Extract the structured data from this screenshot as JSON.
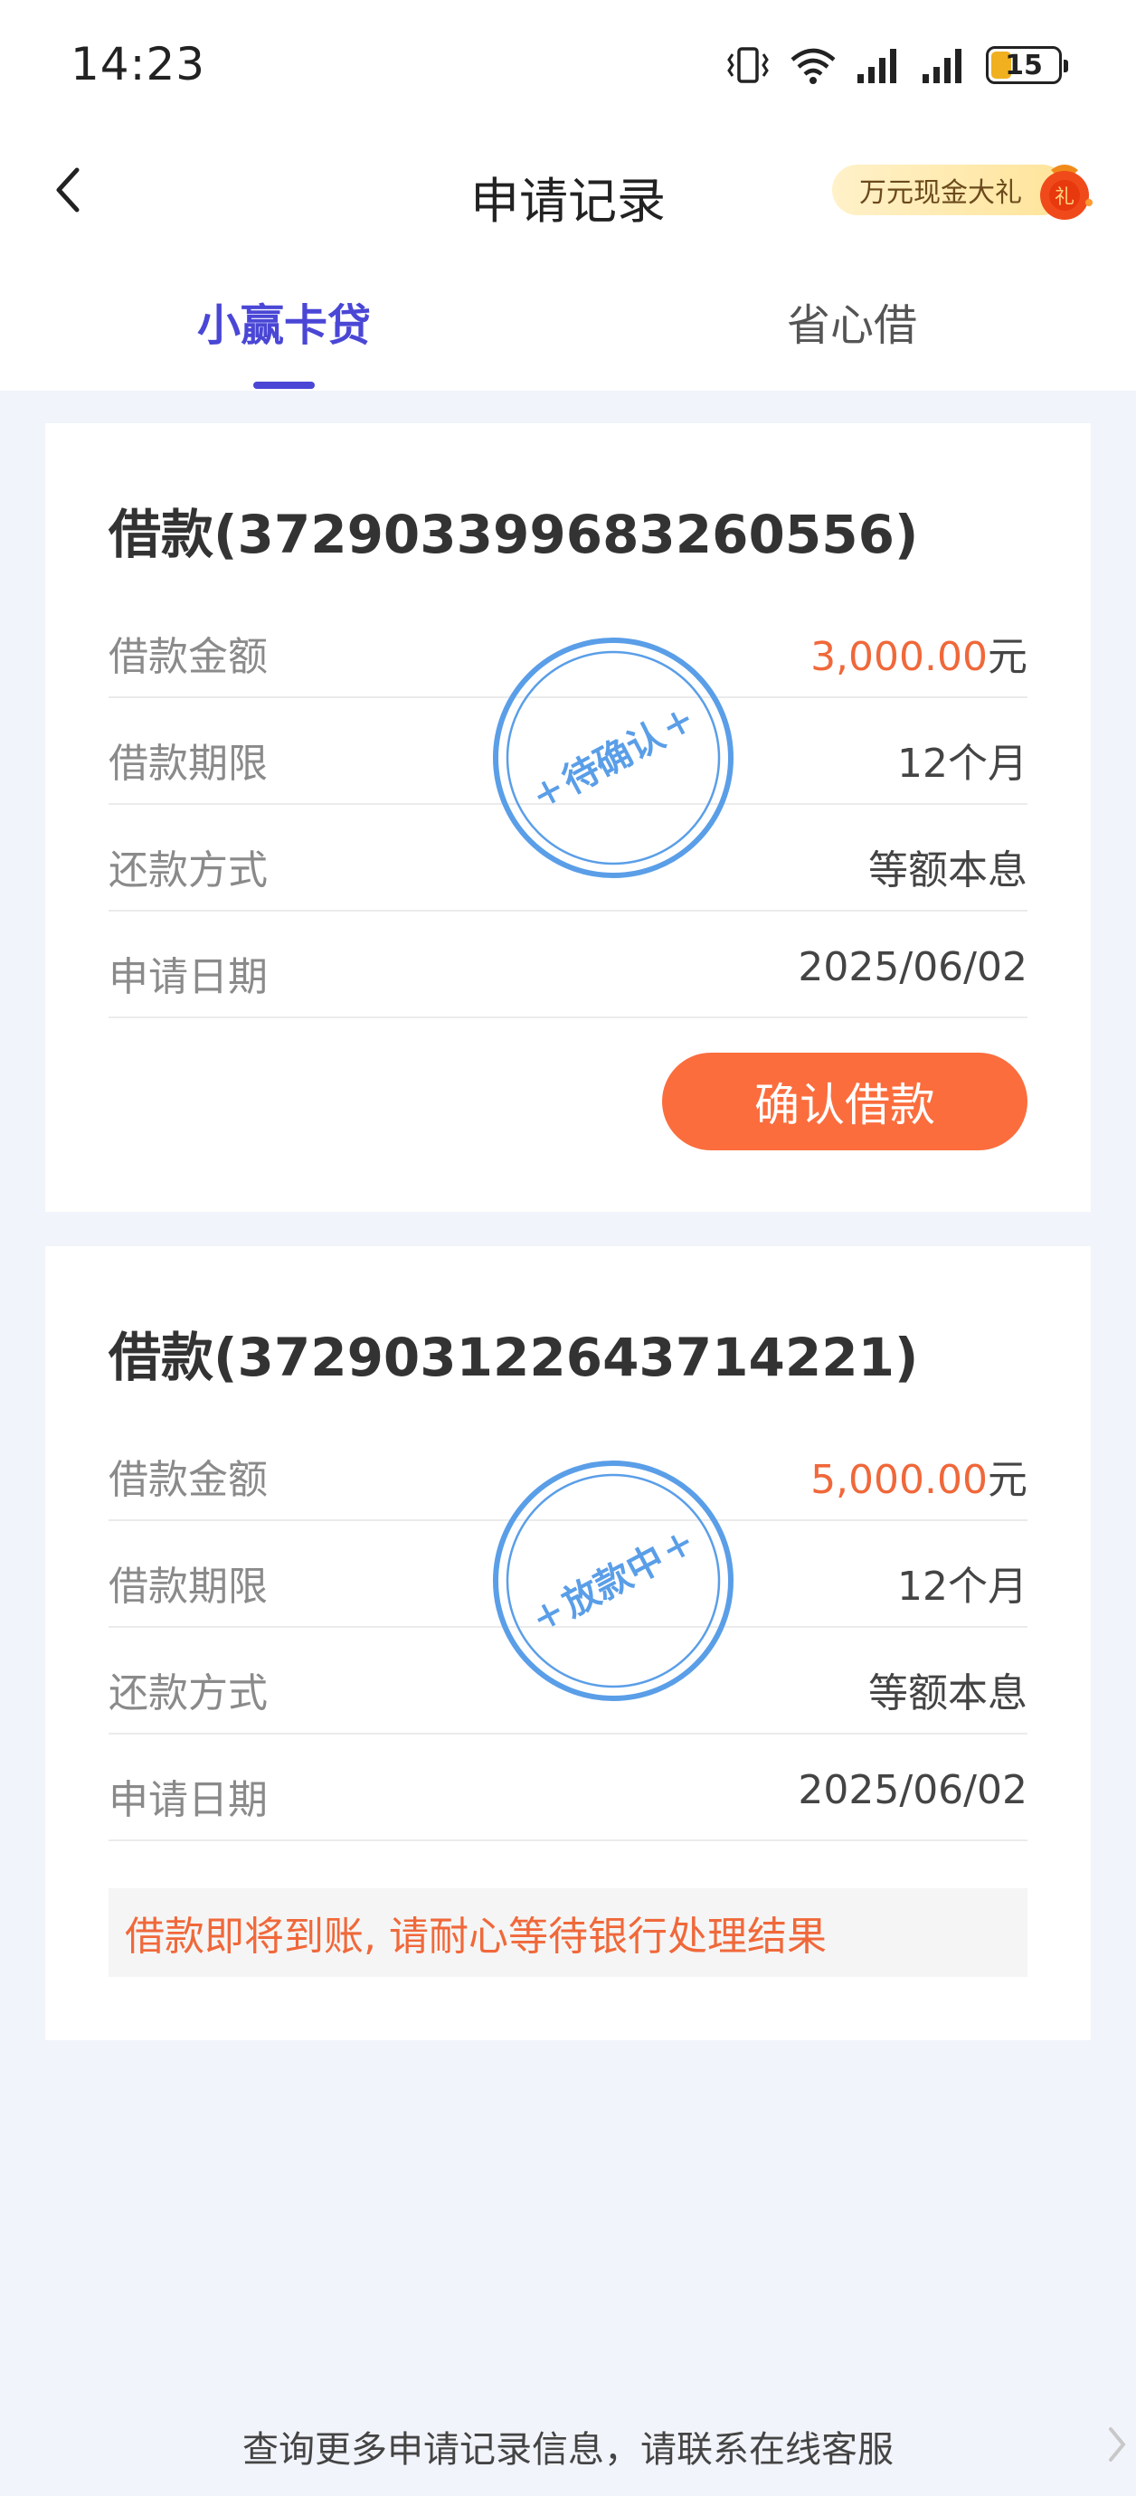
{
  "status_bar": {
    "time": "14:23",
    "battery": "15"
  },
  "header": {
    "title": "申请记录",
    "promo_text": "万元现金大礼",
    "promo_badge": "礼"
  },
  "tabs": [
    {
      "label": "小赢卡贷",
      "active": true
    },
    {
      "label": "省心借",
      "active": false
    }
  ],
  "loans": [
    {
      "title": "借款(372903399683260556)",
      "rows": [
        {
          "label": "借款金额",
          "amount": "3,000.00",
          "unit": "元"
        },
        {
          "label": "借款期限",
          "value": "12个月"
        },
        {
          "label": "还款方式",
          "value": "等额本息"
        },
        {
          "label": "申请日期",
          "value": "2025/06/02"
        }
      ],
      "stamp": "待确认",
      "action_button": "确认借款"
    },
    {
      "title": "借款(372903122643714221)",
      "rows": [
        {
          "label": "借款金额",
          "amount": "5,000.00",
          "unit": "元"
        },
        {
          "label": "借款期限",
          "value": "12个月"
        },
        {
          "label": "还款方式",
          "value": "等额本息"
        },
        {
          "label": "申请日期",
          "value": "2025/06/02"
        }
      ],
      "stamp": "放款中",
      "notice": "借款即将到账, 请耐心等待银行处理结果"
    }
  ],
  "footer": {
    "text": "查询更多申请记录信息，请联系在线客服"
  },
  "colors": {
    "accent": "#4a47d6",
    "orange": "#fb6d3d",
    "amount": "#f0683a",
    "stamp": "#5a9ee8",
    "background": "#f2f4fb"
  }
}
